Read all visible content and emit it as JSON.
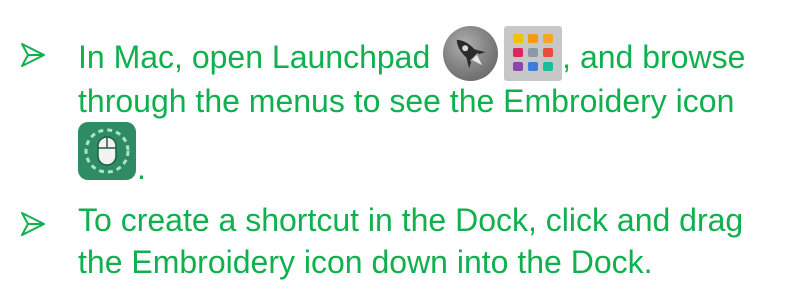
{
  "bullets": [
    {
      "lines": [
        {
          "before": "In Mac, open Launchpad ",
          "after": ", and browse"
        },
        {
          "text": "through the menus to see the Embroidery icon"
        },
        {
          "text": "."
        }
      ],
      "icons": [
        "rocket-icon",
        "launchpad-grid-icon",
        "embroidery-icon"
      ]
    },
    {
      "lines": [
        {
          "text": "To create a shortcut in the Dock, click and drag"
        },
        {
          "text": "the Embroidery icon down into the Dock."
        }
      ]
    }
  ],
  "colors": {
    "text": "#11b04e",
    "embroidery_icon_bg": "#2e8b63",
    "arrow": "#11b04e"
  }
}
